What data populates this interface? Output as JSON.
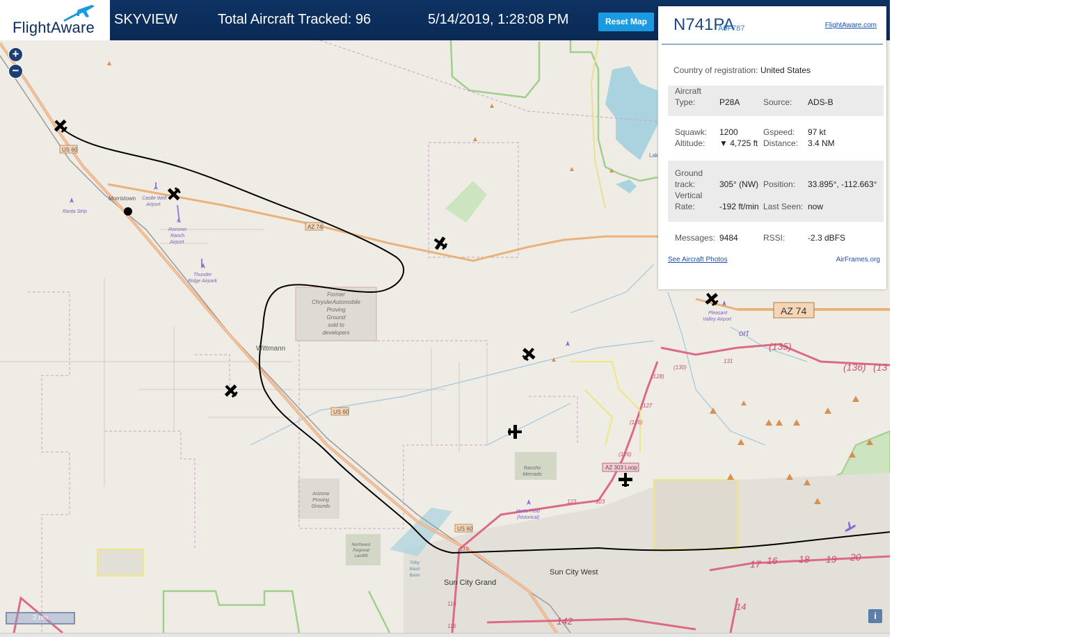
{
  "header": {
    "brand": "FlightAware",
    "app_name": "SKYVIEW",
    "tracked": "Total Aircraft Tracked: 96",
    "datetime": "5/14/2019, 1:28:08 PM",
    "reset_label": "Reset Map"
  },
  "panel": {
    "registration": "N741PA",
    "hex": "A9F787",
    "fa_link": "FlightAware.com",
    "country_label": "Country of registration:",
    "country": "United States",
    "aircraft_type_label": "Aircraft Type:",
    "aircraft_type": "P28A",
    "source_label": "Source:",
    "source": "ADS-B",
    "squawk_label": "Squawk:",
    "squawk": "1200",
    "altitude_label": "Altitude:",
    "altitude": "▼ 4,725 ft",
    "gspeed_label": "Gspeed:",
    "gspeed": "97 kt",
    "distance_label": "Distance:",
    "distance": "3.4 NM",
    "track_label": "Ground track:",
    "track": "305° (NW)",
    "vrate_label": "Vertical Rate:",
    "vrate": "-192 ft/min",
    "position_label": "Position:",
    "position": "33.895°, -112.663°",
    "lastseen_label": "Last Seen:",
    "lastseen": "now",
    "messages_label": "Messages:",
    "messages": "9484",
    "rssi_label": "RSSI:",
    "rssi": "-2.3 dBFS",
    "photos_link": "See Aircraft Photos",
    "airframes_link": "AirFrames.org"
  },
  "map": {
    "scale_label": "2 nm",
    "info": "i",
    "labels": {
      "us60_a": "US 60",
      "us60_b": "US 60",
      "us60_c": "US 60",
      "az74_a": "AZ 74",
      "az74_b": "AZ 74",
      "az303": "AZ 303 Loop",
      "morristown": "Morristown",
      "wittmann": "Wittmann",
      "castle_well": "Castle Well",
      "castle_well2": "Airport",
      "ranta": "Ranta Strip",
      "roesner1": "Roesner",
      "roesner2": "Ranch",
      "roesner3": "Airport",
      "thunder1": "Thunder",
      "thunder2": "Ridge Airpark",
      "chrysler1": "Former",
      "chrysler2": "ChryslerAutomobile",
      "chrysler3": "Proving",
      "chrysler4": "Ground",
      "chrysler5": "sold to",
      "chrysler6": "developers",
      "rancho1": "Rancho",
      "rancho2": "Mercado",
      "azproving1": "Arizona",
      "azproving2": "Proving",
      "azproving3": "Grounds",
      "landfill1": "Northwest",
      "landfill2": "Regional",
      "landfill3": "Landfill",
      "horts1": "Horts Field",
      "horts2": "(historical)",
      "trilby1": "Trilby",
      "trilby2": "Wash",
      "trilby3": "Basin",
      "suncitygrand": "Sun City Grand",
      "suncitywest": "Sun City West",
      "pleasant1": "Pleasant",
      "pleasant2": "Valley Airport",
      "lake": "Lak",
      "ort": "ort",
      "r135": "(135)",
      "r136": "(136)",
      "r130": "(130)",
      "r131": "131",
      "r128": "(128)",
      "r127": "127",
      "r126": "(126)",
      "r125": "(126)",
      "r123a": "123",
      "r123b": "123",
      "r119": "119",
      "r116a": "116",
      "r116b": "116",
      "r142": "142",
      "r14": "14",
      "x16": "16",
      "x17": "17",
      "x18": "18",
      "x19": "19",
      "x20": "20",
      "x13": "(13"
    }
  },
  "colors": {
    "header_bg": "#0e3263",
    "accent": "#1a9ae0",
    "map_bg": "#efece5",
    "track": "#000000",
    "highway_orange": "#e9b27a",
    "highway_red": "#dc6a85"
  }
}
